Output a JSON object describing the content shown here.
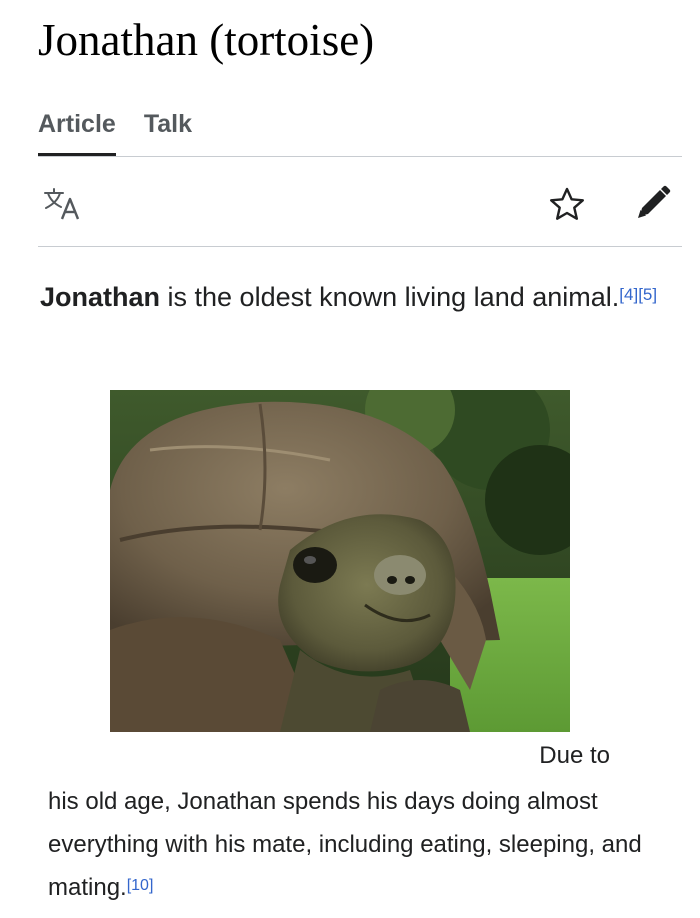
{
  "page": {
    "title": "Jonathan (tortoise)"
  },
  "tabs": [
    {
      "label": "Article",
      "active": true
    },
    {
      "label": "Talk",
      "active": false
    }
  ],
  "toolbar": {
    "language_icon": "translate-icon",
    "watch_icon": "star-icon",
    "edit_icon": "pencil-icon"
  },
  "lead": {
    "subject": "Jonathan",
    "text": " is the oldest known living land animal.",
    "refs": [
      "[4]",
      "[5]"
    ]
  },
  "image": {
    "subject": "tortoise-photo"
  },
  "caption_lead": "Due to",
  "paragraph": {
    "text": "his old age, Jonathan spends his days doing almost everything with his mate, including eating, sleeping, and mating.",
    "refs": [
      "[10]"
    ]
  },
  "colors": {
    "link": "#3366cc",
    "text": "#202122",
    "rule": "#c8ccd1",
    "tab_text": "#54595d"
  }
}
